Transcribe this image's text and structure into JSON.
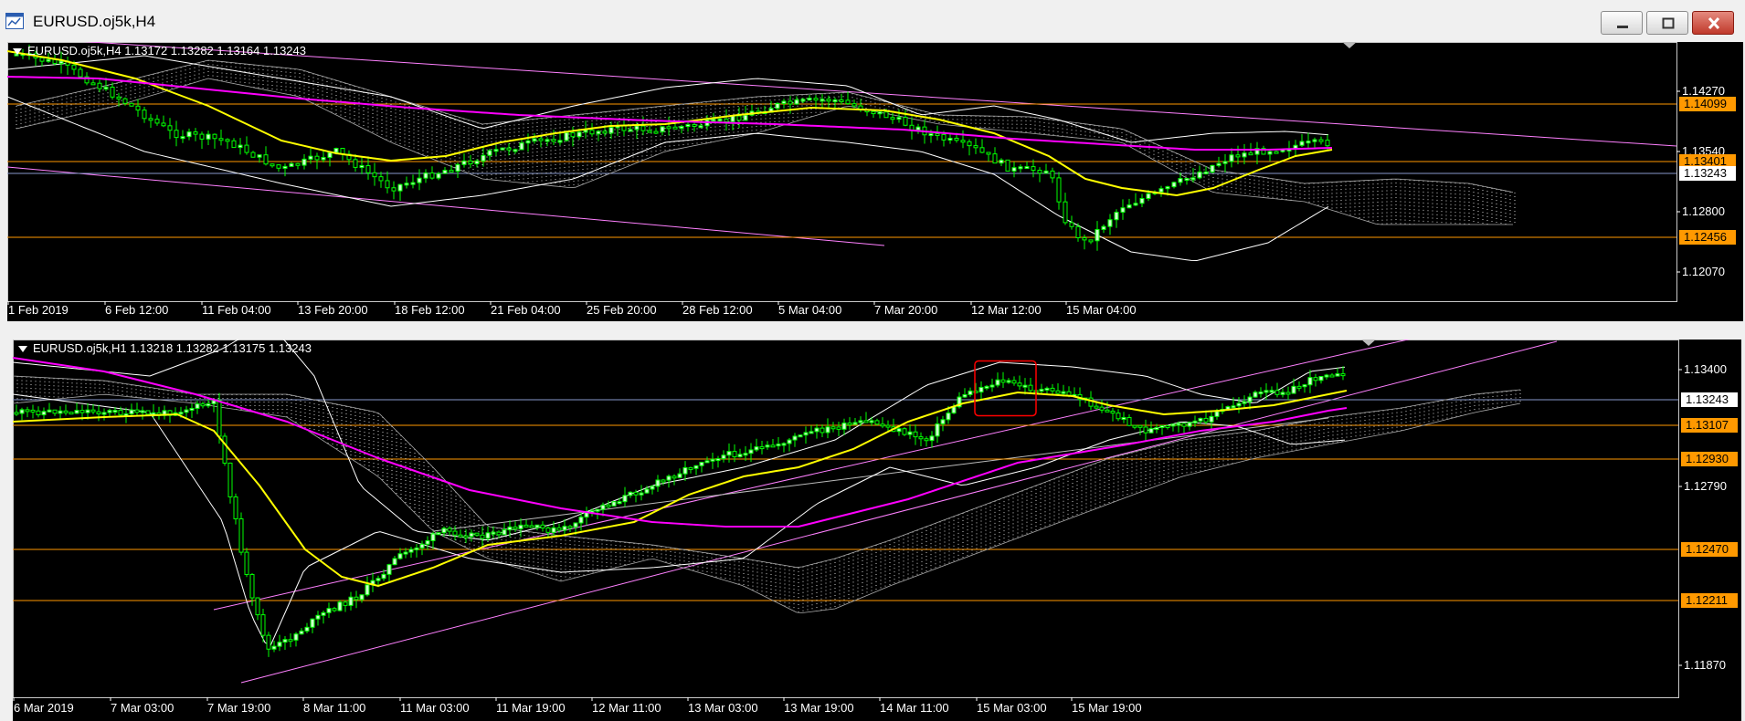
{
  "window": {
    "title": "EURUSD.oj5k,H4",
    "buttons": [
      "minimize-icon",
      "maximize-icon",
      "close-icon"
    ]
  },
  "colors": {
    "background": "#000000",
    "candle_up": "#00ff00",
    "candle_body": "#ccffcc",
    "ma_fast": "#ffff00",
    "ma_slow": "#ff00ff",
    "bollinger": "#ffffff",
    "level_line": "#ff9900",
    "trend_line": "#ff80ff",
    "selection_box": "#ff0000"
  },
  "top_chart": {
    "header": "EURUSD.oj5k,H4  1.13172 1.13282 1.13164 1.13243",
    "price_scale": [
      "1.14270",
      "1.13540",
      "1.12800",
      "1.12070"
    ],
    "level_tags": [
      {
        "value": "1.14099",
        "kind": "orange"
      },
      {
        "value": "1.13401",
        "kind": "orange"
      },
      {
        "value": "1.13243",
        "kind": "white"
      },
      {
        "value": "1.12456",
        "kind": "orange"
      }
    ],
    "time_scale": [
      "1 Feb 2019",
      "6 Feb 12:00",
      "11 Feb 04:00",
      "13 Feb 20:00",
      "18 Feb 12:00",
      "21 Feb 04:00",
      "25 Feb 20:00",
      "28 Feb 12:00",
      "5 Mar 04:00",
      "7 Mar 20:00",
      "12 Mar 12:00",
      "15 Mar 04:00"
    ]
  },
  "bottom_chart": {
    "header": "EURUSD.oj5k,H1  1.13218 1.13282 1.13175 1.13243",
    "price_scale": [
      "1.13400",
      "1.12790",
      "1.11870"
    ],
    "level_tags": [
      {
        "value": "1.13243",
        "kind": "white"
      },
      {
        "value": "1.13107",
        "kind": "orange"
      },
      {
        "value": "1.12930",
        "kind": "orange"
      },
      {
        "value": "1.12470",
        "kind": "orange"
      },
      {
        "value": "1.12211",
        "kind": "orange"
      }
    ],
    "time_scale": [
      "6 Mar 2019",
      "7 Mar 03:00",
      "7 Mar 19:00",
      "8 Mar 11:00",
      "11 Mar 03:00",
      "11 Mar 19:00",
      "12 Mar 11:00",
      "13 Mar 03:00",
      "13 Mar 19:00",
      "14 Mar 11:00",
      "15 Mar 03:00",
      "15 Mar 19:00"
    ]
  }
}
